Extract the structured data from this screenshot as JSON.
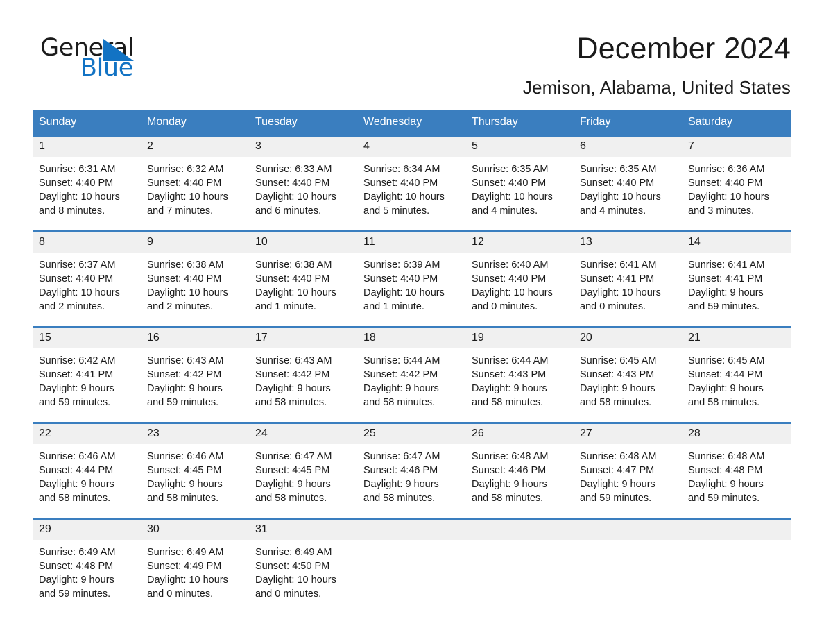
{
  "logo": {
    "word_one": "General",
    "word_two": "Blue",
    "triangle_icon": "blue-triangle-icon",
    "blue": "#1273c4"
  },
  "header": {
    "month_title": "December 2024",
    "location": "Jemison, Alabama, United States"
  },
  "colors": {
    "header_blue": "#3a7ebf",
    "daynum_gray": "#f0f0f0",
    "text": "#1a1a1a",
    "header_text": "#ffffff"
  },
  "calendar": {
    "weekday_headers": [
      "Sunday",
      "Monday",
      "Tuesday",
      "Wednesday",
      "Thursday",
      "Friday",
      "Saturday"
    ],
    "weeks": [
      [
        {
          "day": "1",
          "sunrise": "Sunrise: 6:31 AM",
          "sunset": "Sunset: 4:40 PM",
          "daylight_line1": "Daylight: 10 hours",
          "daylight_line2": "and 8 minutes."
        },
        {
          "day": "2",
          "sunrise": "Sunrise: 6:32 AM",
          "sunset": "Sunset: 4:40 PM",
          "daylight_line1": "Daylight: 10 hours",
          "daylight_line2": "and 7 minutes."
        },
        {
          "day": "3",
          "sunrise": "Sunrise: 6:33 AM",
          "sunset": "Sunset: 4:40 PM",
          "daylight_line1": "Daylight: 10 hours",
          "daylight_line2": "and 6 minutes."
        },
        {
          "day": "4",
          "sunrise": "Sunrise: 6:34 AM",
          "sunset": "Sunset: 4:40 PM",
          "daylight_line1": "Daylight: 10 hours",
          "daylight_line2": "and 5 minutes."
        },
        {
          "day": "5",
          "sunrise": "Sunrise: 6:35 AM",
          "sunset": "Sunset: 4:40 PM",
          "daylight_line1": "Daylight: 10 hours",
          "daylight_line2": "and 4 minutes."
        },
        {
          "day": "6",
          "sunrise": "Sunrise: 6:35 AM",
          "sunset": "Sunset: 4:40 PM",
          "daylight_line1": "Daylight: 10 hours",
          "daylight_line2": "and 4 minutes."
        },
        {
          "day": "7",
          "sunrise": "Sunrise: 6:36 AM",
          "sunset": "Sunset: 4:40 PM",
          "daylight_line1": "Daylight: 10 hours",
          "daylight_line2": "and 3 minutes."
        }
      ],
      [
        {
          "day": "8",
          "sunrise": "Sunrise: 6:37 AM",
          "sunset": "Sunset: 4:40 PM",
          "daylight_line1": "Daylight: 10 hours",
          "daylight_line2": "and 2 minutes."
        },
        {
          "day": "9",
          "sunrise": "Sunrise: 6:38 AM",
          "sunset": "Sunset: 4:40 PM",
          "daylight_line1": "Daylight: 10 hours",
          "daylight_line2": "and 2 minutes."
        },
        {
          "day": "10",
          "sunrise": "Sunrise: 6:38 AM",
          "sunset": "Sunset: 4:40 PM",
          "daylight_line1": "Daylight: 10 hours",
          "daylight_line2": "and 1 minute."
        },
        {
          "day": "11",
          "sunrise": "Sunrise: 6:39 AM",
          "sunset": "Sunset: 4:40 PM",
          "daylight_line1": "Daylight: 10 hours",
          "daylight_line2": "and 1 minute."
        },
        {
          "day": "12",
          "sunrise": "Sunrise: 6:40 AM",
          "sunset": "Sunset: 4:40 PM",
          "daylight_line1": "Daylight: 10 hours",
          "daylight_line2": "and 0 minutes."
        },
        {
          "day": "13",
          "sunrise": "Sunrise: 6:41 AM",
          "sunset": "Sunset: 4:41 PM",
          "daylight_line1": "Daylight: 10 hours",
          "daylight_line2": "and 0 minutes."
        },
        {
          "day": "14",
          "sunrise": "Sunrise: 6:41 AM",
          "sunset": "Sunset: 4:41 PM",
          "daylight_line1": "Daylight: 9 hours",
          "daylight_line2": "and 59 minutes."
        }
      ],
      [
        {
          "day": "15",
          "sunrise": "Sunrise: 6:42 AM",
          "sunset": "Sunset: 4:41 PM",
          "daylight_line1": "Daylight: 9 hours",
          "daylight_line2": "and 59 minutes."
        },
        {
          "day": "16",
          "sunrise": "Sunrise: 6:43 AM",
          "sunset": "Sunset: 4:42 PM",
          "daylight_line1": "Daylight: 9 hours",
          "daylight_line2": "and 59 minutes."
        },
        {
          "day": "17",
          "sunrise": "Sunrise: 6:43 AM",
          "sunset": "Sunset: 4:42 PM",
          "daylight_line1": "Daylight: 9 hours",
          "daylight_line2": "and 58 minutes."
        },
        {
          "day": "18",
          "sunrise": "Sunrise: 6:44 AM",
          "sunset": "Sunset: 4:42 PM",
          "daylight_line1": "Daylight: 9 hours",
          "daylight_line2": "and 58 minutes."
        },
        {
          "day": "19",
          "sunrise": "Sunrise: 6:44 AM",
          "sunset": "Sunset: 4:43 PM",
          "daylight_line1": "Daylight: 9 hours",
          "daylight_line2": "and 58 minutes."
        },
        {
          "day": "20",
          "sunrise": "Sunrise: 6:45 AM",
          "sunset": "Sunset: 4:43 PM",
          "daylight_line1": "Daylight: 9 hours",
          "daylight_line2": "and 58 minutes."
        },
        {
          "day": "21",
          "sunrise": "Sunrise: 6:45 AM",
          "sunset": "Sunset: 4:44 PM",
          "daylight_line1": "Daylight: 9 hours",
          "daylight_line2": "and 58 minutes."
        }
      ],
      [
        {
          "day": "22",
          "sunrise": "Sunrise: 6:46 AM",
          "sunset": "Sunset: 4:44 PM",
          "daylight_line1": "Daylight: 9 hours",
          "daylight_line2": "and 58 minutes."
        },
        {
          "day": "23",
          "sunrise": "Sunrise: 6:46 AM",
          "sunset": "Sunset: 4:45 PM",
          "daylight_line1": "Daylight: 9 hours",
          "daylight_line2": "and 58 minutes."
        },
        {
          "day": "24",
          "sunrise": "Sunrise: 6:47 AM",
          "sunset": "Sunset: 4:45 PM",
          "daylight_line1": "Daylight: 9 hours",
          "daylight_line2": "and 58 minutes."
        },
        {
          "day": "25",
          "sunrise": "Sunrise: 6:47 AM",
          "sunset": "Sunset: 4:46 PM",
          "daylight_line1": "Daylight: 9 hours",
          "daylight_line2": "and 58 minutes."
        },
        {
          "day": "26",
          "sunrise": "Sunrise: 6:48 AM",
          "sunset": "Sunset: 4:46 PM",
          "daylight_line1": "Daylight: 9 hours",
          "daylight_line2": "and 58 minutes."
        },
        {
          "day": "27",
          "sunrise": "Sunrise: 6:48 AM",
          "sunset": "Sunset: 4:47 PM",
          "daylight_line1": "Daylight: 9 hours",
          "daylight_line2": "and 59 minutes."
        },
        {
          "day": "28",
          "sunrise": "Sunrise: 6:48 AM",
          "sunset": "Sunset: 4:48 PM",
          "daylight_line1": "Daylight: 9 hours",
          "daylight_line2": "and 59 minutes."
        }
      ],
      [
        {
          "day": "29",
          "sunrise": "Sunrise: 6:49 AM",
          "sunset": "Sunset: 4:48 PM",
          "daylight_line1": "Daylight: 9 hours",
          "daylight_line2": "and 59 minutes."
        },
        {
          "day": "30",
          "sunrise": "Sunrise: 6:49 AM",
          "sunset": "Sunset: 4:49 PM",
          "daylight_line1": "Daylight: 10 hours",
          "daylight_line2": "and 0 minutes."
        },
        {
          "day": "31",
          "sunrise": "Sunrise: 6:49 AM",
          "sunset": "Sunset: 4:50 PM",
          "daylight_line1": "Daylight: 10 hours",
          "daylight_line2": "and 0 minutes."
        },
        {
          "day": "",
          "sunrise": "",
          "sunset": "",
          "daylight_line1": "",
          "daylight_line2": ""
        },
        {
          "day": "",
          "sunrise": "",
          "sunset": "",
          "daylight_line1": "",
          "daylight_line2": ""
        },
        {
          "day": "",
          "sunrise": "",
          "sunset": "",
          "daylight_line1": "",
          "daylight_line2": ""
        },
        {
          "day": "",
          "sunrise": "",
          "sunset": "",
          "daylight_line1": "",
          "daylight_line2": ""
        }
      ]
    ]
  }
}
